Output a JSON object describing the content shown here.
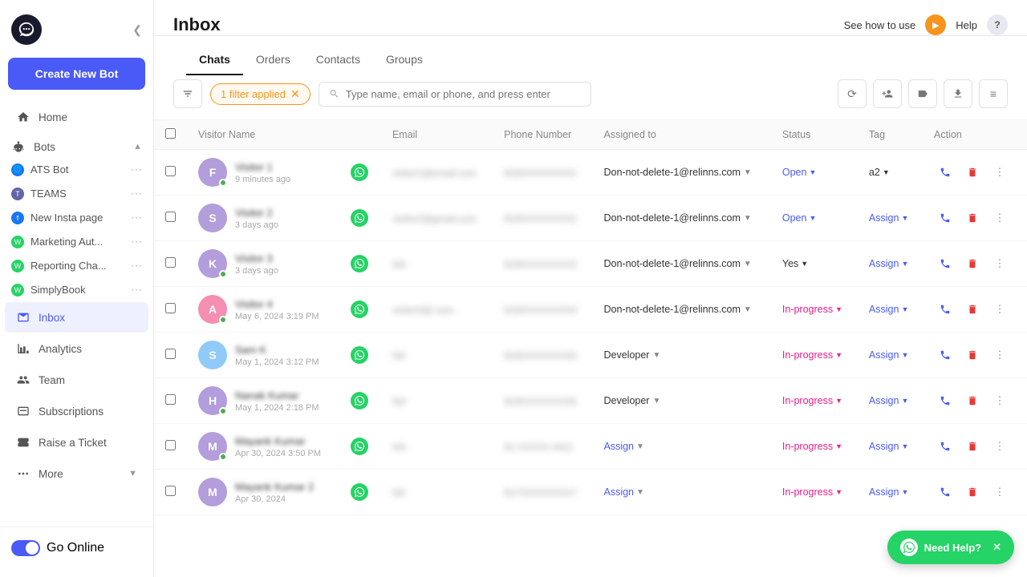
{
  "sidebar": {
    "logo_alt": "Bot Logo",
    "collapse_icon": "❮",
    "create_bot_label": "Create New Bot",
    "nav": [
      {
        "id": "home",
        "icon": "home",
        "label": "Home"
      },
      {
        "id": "bots",
        "icon": "bots",
        "label": "Bots",
        "toggle": "▲"
      },
      {
        "id": "inbox",
        "icon": "inbox",
        "label": "Inbox",
        "active": true
      },
      {
        "id": "analytics",
        "icon": "analytics",
        "label": "Analytics"
      },
      {
        "id": "team",
        "icon": "team",
        "label": "Team"
      },
      {
        "id": "subscriptions",
        "icon": "subscriptions",
        "label": "Subscriptions"
      },
      {
        "id": "raise-ticket",
        "icon": "ticket",
        "label": "Raise a Ticket"
      },
      {
        "id": "more",
        "icon": "more",
        "label": "More",
        "toggle": "▼"
      }
    ],
    "bots": [
      {
        "name": "ATS Bot",
        "icon_type": "globe",
        "color": "blue"
      },
      {
        "name": "TEAMS",
        "icon_type": "teams",
        "color": "teams"
      },
      {
        "name": "New Insta page",
        "icon_type": "fb",
        "color": "blue"
      },
      {
        "name": "Marketing Aut...",
        "icon_type": "wa",
        "color": "green"
      },
      {
        "name": "Reporting Cha...",
        "icon_type": "wa",
        "color": "green"
      },
      {
        "name": "SimplyBook",
        "icon_type": "wa",
        "color": "green"
      }
    ],
    "go_online_label": "Go Online"
  },
  "header": {
    "title": "Inbox",
    "see_how_label": "See how to use",
    "help_label": "Help",
    "play_icon": "▶",
    "help_icon": "?"
  },
  "tabs": [
    {
      "id": "chats",
      "label": "Chats",
      "active": true
    },
    {
      "id": "orders",
      "label": "Orders"
    },
    {
      "id": "contacts",
      "label": "Contacts"
    },
    {
      "id": "groups",
      "label": "Groups"
    }
  ],
  "toolbar": {
    "filter_icon": "▼",
    "filter_badge": "1 filter applied",
    "search_placeholder": "Type name, email or phone, and press enter",
    "action_icons": [
      "⟳",
      "👤+",
      "🏷",
      "⬇",
      "≡"
    ]
  },
  "table": {
    "columns": [
      "",
      "Visitor Name",
      "",
      "Email",
      "Phone Number",
      "Assigned to",
      "Status",
      "Tag",
      "Action"
    ],
    "rows": [
      {
        "avatar_letter": "F",
        "avatar_color": "purple",
        "online": true,
        "name": "Visitor 1",
        "time": "9 minutes ago",
        "wa": true,
        "email": "visitor1@email.com",
        "phone": "919XXXXXXXX1",
        "assigned": "Don-not-delete-1@relinns.com",
        "status": "Open",
        "status_type": "open",
        "tag": "a2",
        "tag_type": "label"
      },
      {
        "avatar_letter": "S",
        "avatar_color": "purple",
        "online": false,
        "name": "Visitor 2",
        "time": "3 days ago",
        "wa": true,
        "email": "visitor2@gmail.com",
        "phone": "919XXXXXXXX2",
        "assigned": "Don-not-delete-1@relinns.com",
        "status": "Open",
        "status_type": "open",
        "tag": "Assign",
        "tag_type": "assign"
      },
      {
        "avatar_letter": "K",
        "avatar_color": "purple",
        "online": true,
        "name": "Visitor 3",
        "time": "3 days ago",
        "wa": true,
        "email": "NA",
        "phone": "919XXXXXXXX3",
        "assigned": "Don-not-delete-1@relinns.com",
        "status": "Yes",
        "status_type": "yes",
        "tag": "Assign",
        "tag_type": "assign"
      },
      {
        "avatar_letter": "A",
        "avatar_color": "pink",
        "online": true,
        "name": "Visitor 4",
        "time": "May 6, 2024 3:19 PM",
        "wa": true,
        "email": "visitor4@.com",
        "phone": "919XXXXXXXX4",
        "assigned": "Don-not-delete-1@relinns.com",
        "status": "In-progress",
        "status_type": "inprogress",
        "tag": "Assign",
        "tag_type": "assign"
      },
      {
        "avatar_letter": "S",
        "avatar_color": "blue",
        "online": false,
        "name": "Sam K",
        "time": "May 1, 2024 3:12 PM",
        "wa": true,
        "email": "NA",
        "phone": "919XXXXXXXX5",
        "assigned": "Developer",
        "status": "In-progress",
        "status_type": "inprogress",
        "tag": "Assign",
        "tag_type": "assign"
      },
      {
        "avatar_letter": "H",
        "avatar_color": "purple",
        "online": true,
        "name": "Nanak Kumar",
        "time": "May 1, 2024 2:18 PM",
        "wa": true,
        "email": "NA",
        "phone": "919XXXXXXXX6",
        "assigned": "Developer",
        "status": "In-progress",
        "status_type": "inprogress",
        "tag": "Assign",
        "tag_type": "assign"
      },
      {
        "avatar_letter": "M",
        "avatar_color": "purple",
        "online": true,
        "name": "Mayank Kumar",
        "time": "Apr 30, 2024 3:50 PM",
        "wa": true,
        "email": "NA",
        "phone": "91 XXXXX 4411",
        "assigned": "Assign",
        "assigned_type": "assign",
        "status": "In-progress",
        "status_type": "inprogress",
        "tag": "Assign",
        "tag_type": "assign"
      },
      {
        "avatar_letter": "M",
        "avatar_color": "purple",
        "online": false,
        "name": "Mayank Kumar 2",
        "time": "Apr 30, 2024",
        "wa": true,
        "email": "NA",
        "phone": "917XXXXXXXX7",
        "assigned": "Assign",
        "assigned_type": "assign",
        "status": "In-progress",
        "status_type": "inprogress",
        "tag": "Assign",
        "tag_type": "assign"
      }
    ]
  },
  "help_float": {
    "label": "Need  Help?",
    "close": "✕"
  }
}
